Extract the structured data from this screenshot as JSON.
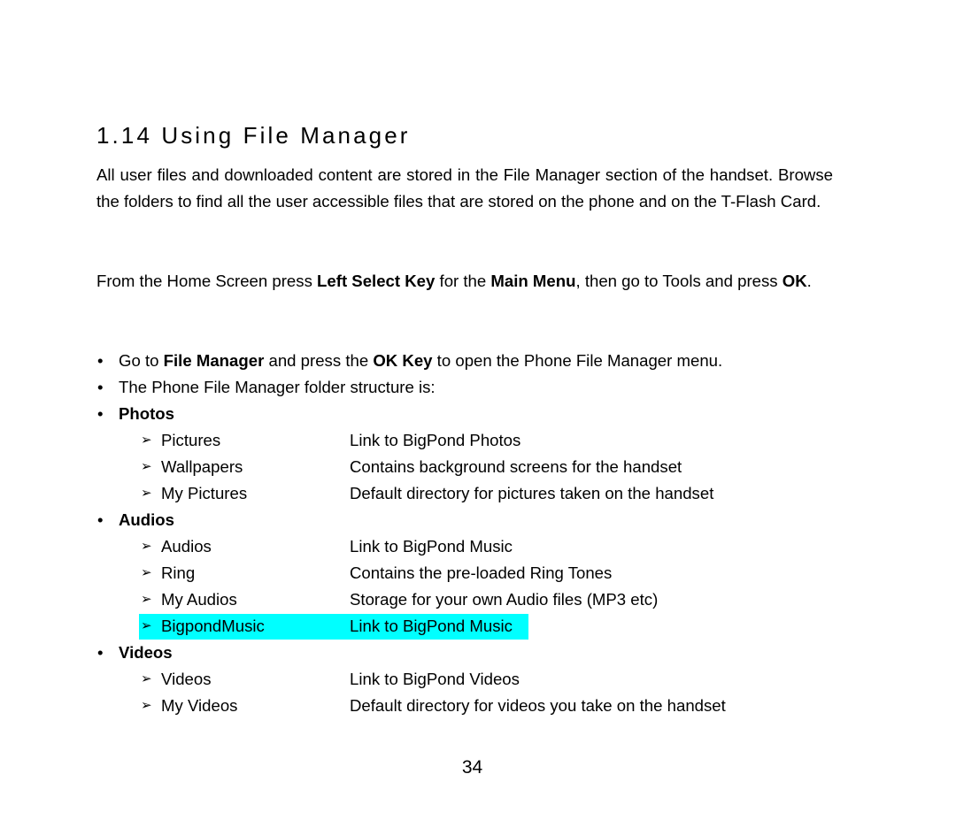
{
  "heading": "1.14  Using File Manager",
  "intro": "All user files and downloaded content are stored in the File Manager section of the handset. Browse the folders to find all the user accessible files that are stored on the phone and on the T-Flash Card.",
  "instruction": {
    "t1": "From the Home Screen press ",
    "b1": "Left Select Key",
    "t2": " for the ",
    "b2": "Main Menu",
    "t3": ", then go to Tools and press ",
    "b3": "OK",
    "t4": "."
  },
  "bullets": {
    "b1": {
      "t1": "Go to ",
      "bold1": "File Manager",
      "t2": " and press the ",
      "bold2": "OK Key",
      "t3": " to open the Phone File Manager menu."
    },
    "b2": "The Phone File Manager folder structure is:"
  },
  "bullet_glyph": "•",
  "arrow_glyph": "➢",
  "sections": [
    {
      "title": "Photos",
      "items": [
        {
          "name": "Pictures",
          "desc": "Link to BigPond Photos"
        },
        {
          "name": "Wallpapers",
          "desc": "Contains background screens for the handset"
        },
        {
          "name": "My Pictures",
          "desc": "Default directory for pictures taken on the handset"
        }
      ]
    },
    {
      "title": "Audios",
      "items": [
        {
          "name": "Audios",
          "desc": "Link to BigPond Music"
        },
        {
          "name": "Ring",
          "desc": "Contains the pre-loaded Ring Tones"
        },
        {
          "name": "My Audios",
          "desc": "Storage for your own Audio files (MP3 etc)"
        },
        {
          "name": "BigpondMusic",
          "desc": "Link to BigPond Music",
          "highlighted": true
        }
      ]
    },
    {
      "title": "Videos",
      "items": [
        {
          "name": "Videos",
          "desc": "Link to BigPond Videos"
        },
        {
          "name": "My Videos",
          "desc": "Default directory for videos you take on the handset"
        }
      ]
    }
  ],
  "highlight_color": "#00ffff",
  "page_number": "34"
}
